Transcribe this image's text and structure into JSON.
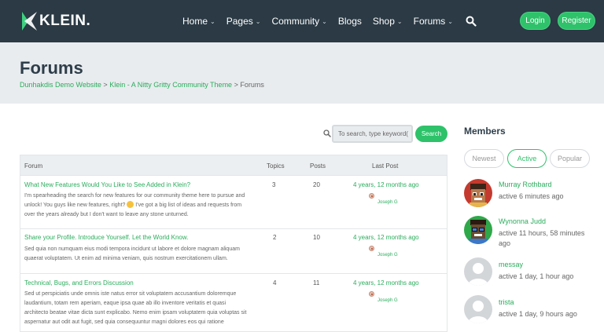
{
  "header": {
    "logo_text": "KLEIN.",
    "nav": [
      {
        "label": "Home",
        "dropdown": true
      },
      {
        "label": "Pages",
        "dropdown": true
      },
      {
        "label": "Community",
        "dropdown": true
      },
      {
        "label": "Blogs",
        "dropdown": false
      },
      {
        "label": "Shop",
        "dropdown": true
      },
      {
        "label": "Forums",
        "dropdown": true
      }
    ],
    "login_label": "Login",
    "register_label": "Register"
  },
  "page": {
    "title": "Forums",
    "breadcrumb": [
      {
        "label": "Dunhakdis Demo Website",
        "link": true
      },
      {
        "label": "Klein - A Nitty Gritty Community Theme",
        "link": true
      },
      {
        "label": "Forums",
        "link": false
      }
    ],
    "breadcrumb_sep": ">"
  },
  "search": {
    "placeholder": "To search, type keyword(",
    "button_label": "Search"
  },
  "table": {
    "headers": {
      "forum": "Forum",
      "topics": "Topics",
      "posts": "Posts",
      "last_post": "Last Post"
    },
    "rows": [
      {
        "title": "What New Features Would You Like to See Added in Klein?",
        "desc_lines": [
          "I'm spearheading the search for new features for our community theme here to pursue and",
          "unlock! You guys like new features, right? ",
          "over the years already but I don't want to leave any stone unturned."
        ],
        "desc_line2_tail": " I've got a big list of ideas and requests from",
        "topics": "3",
        "posts": "20",
        "last_post": "4 years, 12 months ago",
        "last_user": "Joseph G"
      },
      {
        "title": "Share your Profile. Introduce Yourself. Let the World Know.",
        "desc_lines": [
          "Sed quia non numquam eius modi tempora incidunt ut labore et dolore magnam aliquam",
          "quaerat voluptatem. Ut enim ad minima veniam, quis nostrum exercitationem ullam."
        ],
        "topics": "2",
        "posts": "10",
        "last_post": "4 years, 12 months ago",
        "last_user": "Joseph G"
      },
      {
        "title": "Technical, Bugs, and Errors Discussion",
        "desc_lines": [
          "Sed ut perspiciatis unde omnis iste natus error sit voluptatem accusantium doloremque",
          "laudantium, totam rem aperiam, eaque ipsa quae ab illo inventore veritatis et quasi",
          "architecto beatae vitae dicta sunt explicabo. Nemo enim ipsam voluptatem quia voluptas sit",
          "aspernatur aut odit aut fugit, sed quia consequuntur magni dolores eos qui ratione"
        ],
        "topics": "4",
        "posts": "11",
        "last_post": "4 years, 12 months ago",
        "last_user": "Joseph G"
      }
    ]
  },
  "sidebar": {
    "title": "Members",
    "tabs": [
      {
        "label": "Newest",
        "active": false
      },
      {
        "label": "Active",
        "active": true
      },
      {
        "label": "Popular",
        "active": false
      }
    ],
    "members": [
      {
        "name": "Murray Rothbard",
        "time": "active 6 minutes ago"
      },
      {
        "name": "Wynonna Judd",
        "time": "active 11 hours, 58 minutes ago"
      },
      {
        "name": "messay",
        "time": "active 1 day, 1 hour ago"
      },
      {
        "name": "trista",
        "time": "active 1 day, 9 hours ago"
      }
    ]
  },
  "colors": {
    "header_bg": "#2b3a45",
    "accent": "#2ec26a",
    "link": "#2aad5c",
    "title_band": "#e9ecef"
  }
}
